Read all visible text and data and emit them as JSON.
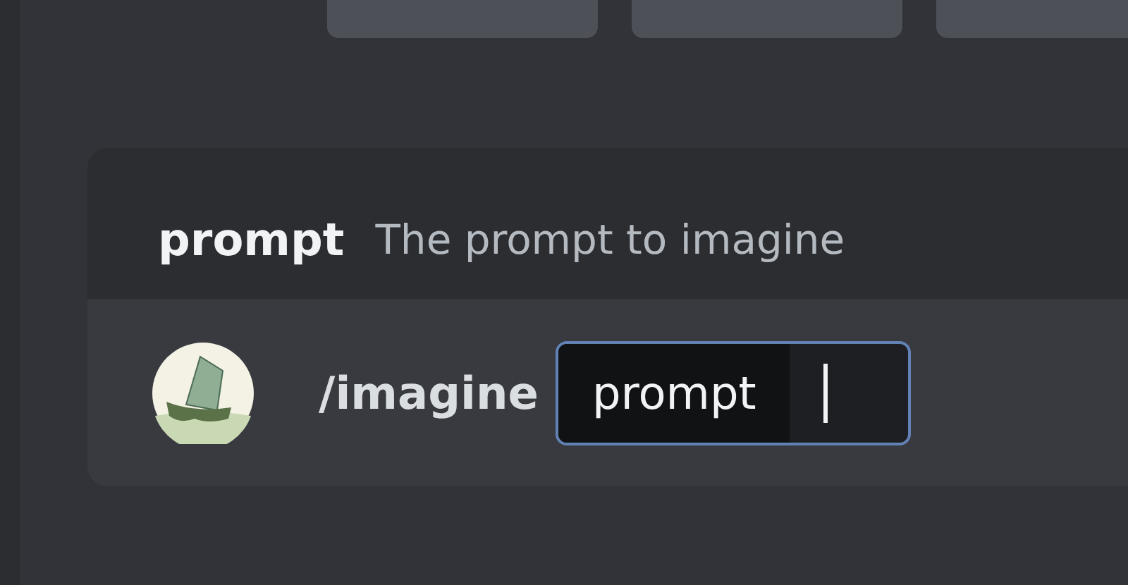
{
  "option_header": {
    "name": "prompt",
    "description": "The prompt to imagine"
  },
  "command": {
    "name": "/imagine",
    "option_chip": "prompt"
  }
}
